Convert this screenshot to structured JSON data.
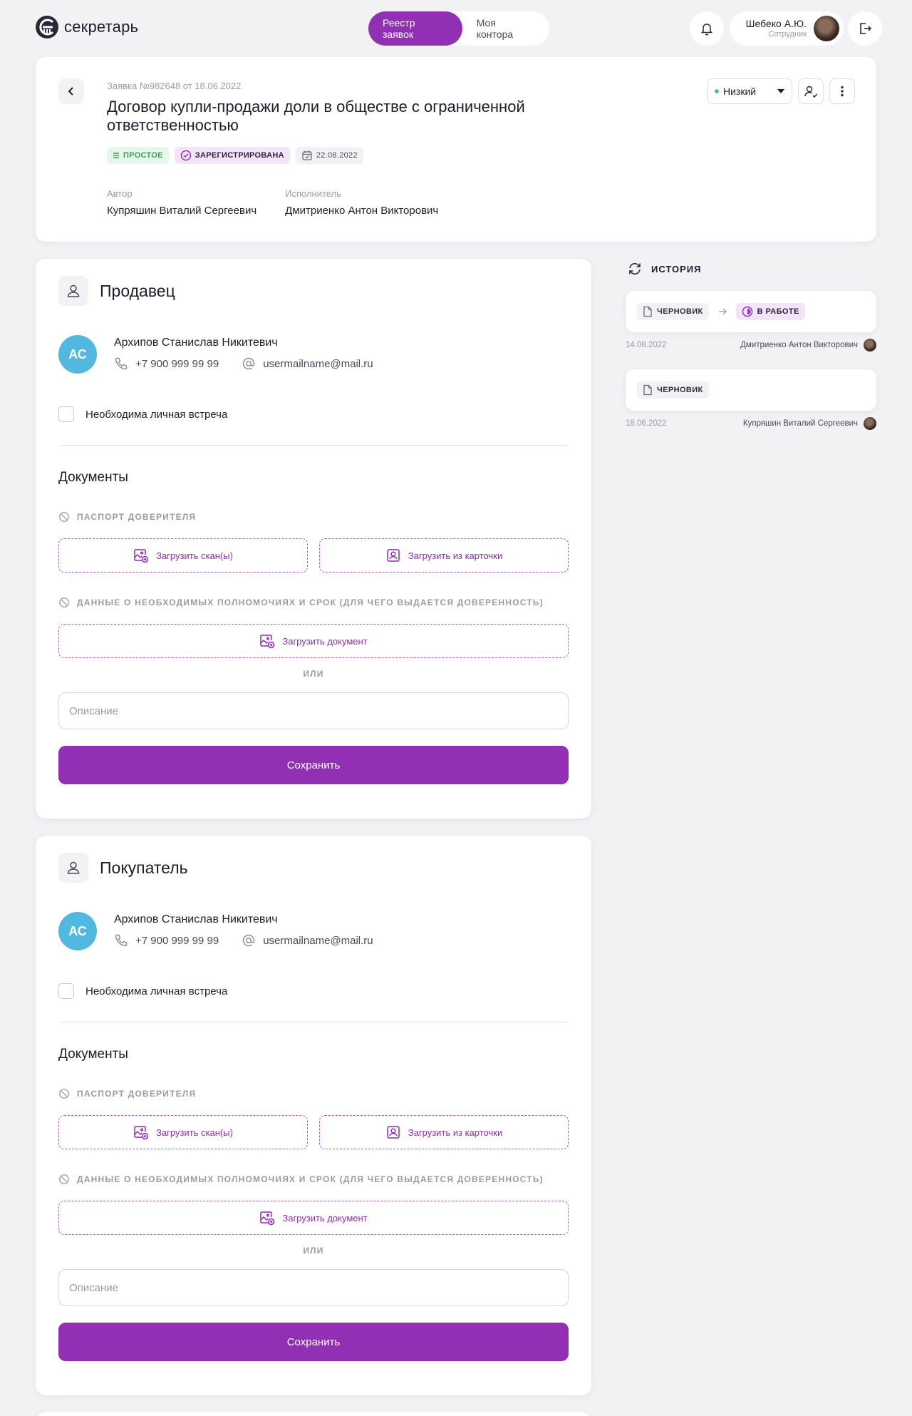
{
  "app": {
    "logo_text": "секретарь"
  },
  "nav": {
    "tabs": [
      {
        "label": "Реестр заявок",
        "active": true
      },
      {
        "label": "Моя контора",
        "active": false
      }
    ]
  },
  "user": {
    "name": "Шебеко А.Ю.",
    "role": "Сотрудник"
  },
  "request": {
    "meta": "Заявка №982648 от 18.06.2022",
    "title": "Договор купли-продажи доли в обществе с ограниченной ответственностью",
    "badges": {
      "type": "ПРОСТОЕ",
      "status": "ЗАРЕГИСТРИРОВАНА",
      "date": "22.08.2022"
    },
    "author_label": "Автор",
    "author": "Купряшин Виталий Сергеевич",
    "executor_label": "Исполнитель",
    "executor": "Дмитриенко Антон Викторович",
    "priority": "Низкий"
  },
  "colors": {
    "accent": "#9230b4",
    "avatar": "#53b8e0",
    "success": "#3aa15a"
  },
  "parties": [
    {
      "title": "Продавец",
      "initials": "АС",
      "name": "Архипов Станислав Никитевич",
      "phone": "+7 900 999 99 99",
      "email": "usermailname@mail.ru",
      "meeting_label": "Необходима личная встреча",
      "docs_title": "Документы",
      "doc1_label": "ПАСПОРТ ДОВЕРИТЕЛЯ",
      "upload_scans": "Загрузить скан(ы)",
      "upload_card": "Загрузить из карточки",
      "doc2_label": "ДАННЫЕ О НЕОБХОДИМЫХ ПОЛНОМОЧИЯХ И СРОК (ДЛЯ ЧЕГО ВЫДАЕТСЯ ДОВЕРЕННОСТЬ)",
      "upload_doc": "Загрузить документ",
      "or": "ИЛИ",
      "desc_placeholder": "Описание",
      "save": "Сохранить"
    },
    {
      "title": "Покупатель",
      "initials": "АС",
      "name": "Архипов Станислав Никитевич",
      "phone": "+7 900 999 99 99",
      "email": "usermailname@mail.ru",
      "meeting_label": "Необходима личная встреча",
      "docs_title": "Документы",
      "doc1_label": "ПАСПОРТ ДОВЕРИТЕЛЯ",
      "upload_scans": "Загрузить скан(ы)",
      "upload_card": "Загрузить из карточки",
      "doc2_label": "ДАННЫЕ О НЕОБХОДИМЫХ ПОЛНОМОЧИЯХ И СРОК (ДЛЯ ЧЕГО ВЫДАЕТСЯ ДОВЕРЕННОСТЬ)",
      "upload_doc": "Загрузить документ",
      "or": "ИЛИ",
      "desc_placeholder": "Описание",
      "save": "Сохранить"
    }
  ],
  "history": {
    "title": "ИСТОРИЯ",
    "entries": [
      {
        "from": "ЧЕРНОВИК",
        "to": "В РАБОТЕ",
        "date": "14.08.2022",
        "who": "Дмитриенко Антон Викторович"
      },
      {
        "from": "ЧЕРНОВИК",
        "date": "18.06.2022",
        "who": "Купряшин Виталий Сергеевич"
      }
    ]
  }
}
